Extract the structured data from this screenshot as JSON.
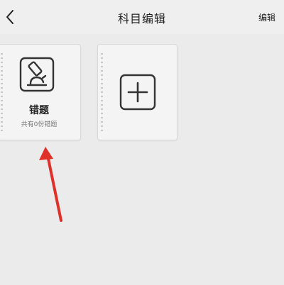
{
  "header": {
    "title": "科目编辑",
    "edit_label": "编辑"
  },
  "cards": {
    "wrong_questions": {
      "label": "错题",
      "count_text": "共有0份错题",
      "icon": "microscope-icon"
    },
    "add": {
      "icon": "plus-icon"
    }
  },
  "annotation": {
    "arrow_color": "#e0302a"
  }
}
